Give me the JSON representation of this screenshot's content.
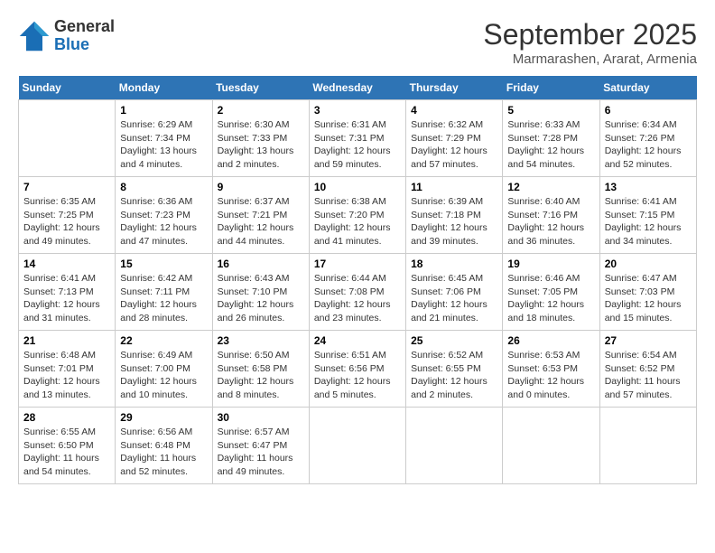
{
  "logo": {
    "line1": "General",
    "line2": "Blue"
  },
  "title": "September 2025",
  "subtitle": "Marmarashen, Ararat, Armenia",
  "weekdays": [
    "Sunday",
    "Monday",
    "Tuesday",
    "Wednesday",
    "Thursday",
    "Friday",
    "Saturday"
  ],
  "weeks": [
    [
      {
        "day": "",
        "info": ""
      },
      {
        "day": "1",
        "info": "Sunrise: 6:29 AM\nSunset: 7:34 PM\nDaylight: 13 hours\nand 4 minutes."
      },
      {
        "day": "2",
        "info": "Sunrise: 6:30 AM\nSunset: 7:33 PM\nDaylight: 13 hours\nand 2 minutes."
      },
      {
        "day": "3",
        "info": "Sunrise: 6:31 AM\nSunset: 7:31 PM\nDaylight: 12 hours\nand 59 minutes."
      },
      {
        "day": "4",
        "info": "Sunrise: 6:32 AM\nSunset: 7:29 PM\nDaylight: 12 hours\nand 57 minutes."
      },
      {
        "day": "5",
        "info": "Sunrise: 6:33 AM\nSunset: 7:28 PM\nDaylight: 12 hours\nand 54 minutes."
      },
      {
        "day": "6",
        "info": "Sunrise: 6:34 AM\nSunset: 7:26 PM\nDaylight: 12 hours\nand 52 minutes."
      }
    ],
    [
      {
        "day": "7",
        "info": "Sunrise: 6:35 AM\nSunset: 7:25 PM\nDaylight: 12 hours\nand 49 minutes."
      },
      {
        "day": "8",
        "info": "Sunrise: 6:36 AM\nSunset: 7:23 PM\nDaylight: 12 hours\nand 47 minutes."
      },
      {
        "day": "9",
        "info": "Sunrise: 6:37 AM\nSunset: 7:21 PM\nDaylight: 12 hours\nand 44 minutes."
      },
      {
        "day": "10",
        "info": "Sunrise: 6:38 AM\nSunset: 7:20 PM\nDaylight: 12 hours\nand 41 minutes."
      },
      {
        "day": "11",
        "info": "Sunrise: 6:39 AM\nSunset: 7:18 PM\nDaylight: 12 hours\nand 39 minutes."
      },
      {
        "day": "12",
        "info": "Sunrise: 6:40 AM\nSunset: 7:16 PM\nDaylight: 12 hours\nand 36 minutes."
      },
      {
        "day": "13",
        "info": "Sunrise: 6:41 AM\nSunset: 7:15 PM\nDaylight: 12 hours\nand 34 minutes."
      }
    ],
    [
      {
        "day": "14",
        "info": "Sunrise: 6:41 AM\nSunset: 7:13 PM\nDaylight: 12 hours\nand 31 minutes."
      },
      {
        "day": "15",
        "info": "Sunrise: 6:42 AM\nSunset: 7:11 PM\nDaylight: 12 hours\nand 28 minutes."
      },
      {
        "day": "16",
        "info": "Sunrise: 6:43 AM\nSunset: 7:10 PM\nDaylight: 12 hours\nand 26 minutes."
      },
      {
        "day": "17",
        "info": "Sunrise: 6:44 AM\nSunset: 7:08 PM\nDaylight: 12 hours\nand 23 minutes."
      },
      {
        "day": "18",
        "info": "Sunrise: 6:45 AM\nSunset: 7:06 PM\nDaylight: 12 hours\nand 21 minutes."
      },
      {
        "day": "19",
        "info": "Sunrise: 6:46 AM\nSunset: 7:05 PM\nDaylight: 12 hours\nand 18 minutes."
      },
      {
        "day": "20",
        "info": "Sunrise: 6:47 AM\nSunset: 7:03 PM\nDaylight: 12 hours\nand 15 minutes."
      }
    ],
    [
      {
        "day": "21",
        "info": "Sunrise: 6:48 AM\nSunset: 7:01 PM\nDaylight: 12 hours\nand 13 minutes."
      },
      {
        "day": "22",
        "info": "Sunrise: 6:49 AM\nSunset: 7:00 PM\nDaylight: 12 hours\nand 10 minutes."
      },
      {
        "day": "23",
        "info": "Sunrise: 6:50 AM\nSunset: 6:58 PM\nDaylight: 12 hours\nand 8 minutes."
      },
      {
        "day": "24",
        "info": "Sunrise: 6:51 AM\nSunset: 6:56 PM\nDaylight: 12 hours\nand 5 minutes."
      },
      {
        "day": "25",
        "info": "Sunrise: 6:52 AM\nSunset: 6:55 PM\nDaylight: 12 hours\nand 2 minutes."
      },
      {
        "day": "26",
        "info": "Sunrise: 6:53 AM\nSunset: 6:53 PM\nDaylight: 12 hours\nand 0 minutes."
      },
      {
        "day": "27",
        "info": "Sunrise: 6:54 AM\nSunset: 6:52 PM\nDaylight: 11 hours\nand 57 minutes."
      }
    ],
    [
      {
        "day": "28",
        "info": "Sunrise: 6:55 AM\nSunset: 6:50 PM\nDaylight: 11 hours\nand 54 minutes."
      },
      {
        "day": "29",
        "info": "Sunrise: 6:56 AM\nSunset: 6:48 PM\nDaylight: 11 hours\nand 52 minutes."
      },
      {
        "day": "30",
        "info": "Sunrise: 6:57 AM\nSunset: 6:47 PM\nDaylight: 11 hours\nand 49 minutes."
      },
      {
        "day": "",
        "info": ""
      },
      {
        "day": "",
        "info": ""
      },
      {
        "day": "",
        "info": ""
      },
      {
        "day": "",
        "info": ""
      }
    ]
  ]
}
